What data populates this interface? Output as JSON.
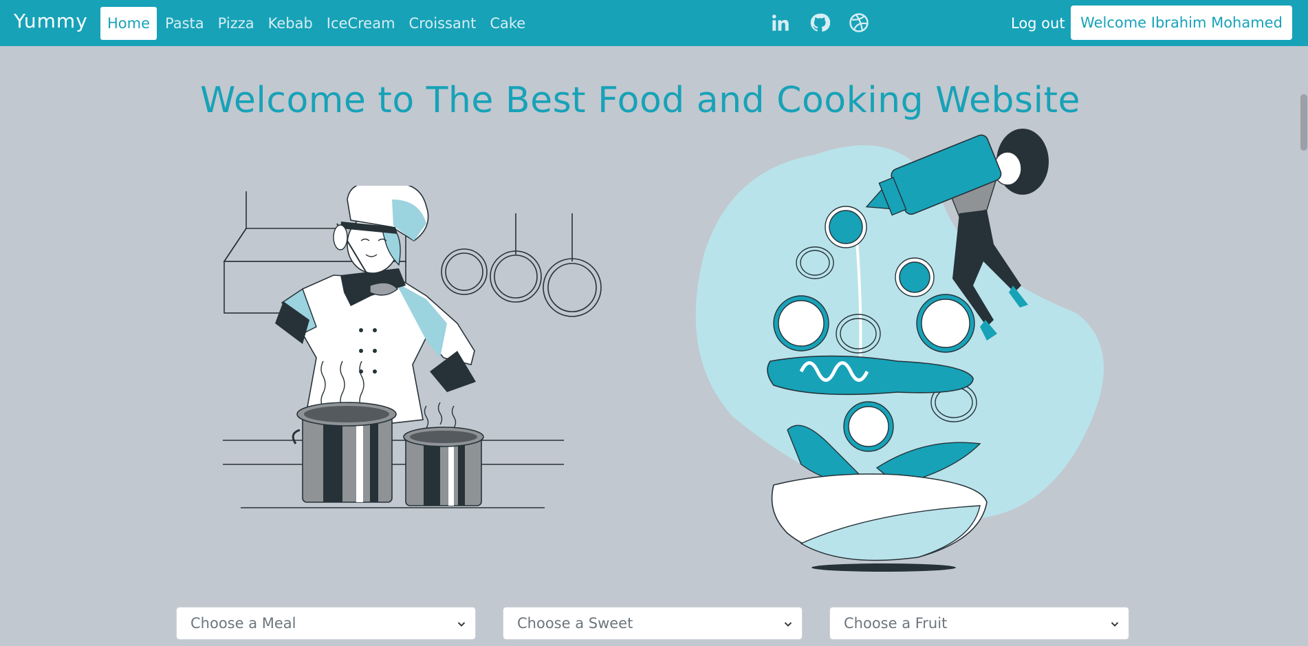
{
  "navbar": {
    "brand": "Yummy",
    "links": [
      {
        "label": "Home",
        "active": true
      },
      {
        "label": "Pasta",
        "active": false
      },
      {
        "label": "Pizza",
        "active": false
      },
      {
        "label": "Kebab",
        "active": false
      },
      {
        "label": "IceCream",
        "active": false
      },
      {
        "label": "Croissant",
        "active": false
      },
      {
        "label": "Cake",
        "active": false
      }
    ],
    "social_icons": [
      "linkedin-icon",
      "github-icon",
      "dribbble-icon"
    ],
    "logout_label": "Log out",
    "welcome_label": "Welcome Ibrahim Mohamed"
  },
  "hero": {
    "title": "Welcome to The Best Food and Cooking Website"
  },
  "selects": [
    {
      "placeholder": "Choose a Meal"
    },
    {
      "placeholder": "Choose a Sweet"
    },
    {
      "placeholder": "Choose a Fruit"
    }
  ],
  "colors": {
    "accent": "#17a2b8",
    "background": "#c2c8cf",
    "dark": "#263238",
    "light_blue": "#b9e3ea"
  }
}
